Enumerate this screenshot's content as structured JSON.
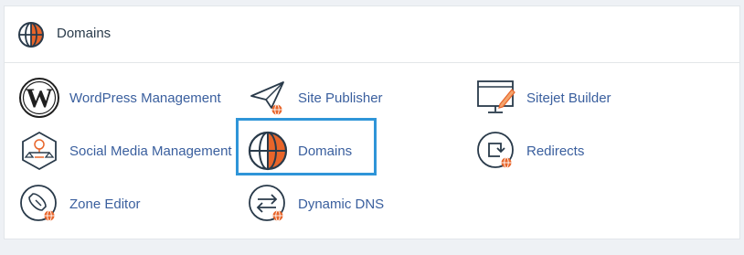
{
  "header": {
    "title": "Domains",
    "icon": "globe-icon"
  },
  "items": [
    {
      "label": "WordPress Management",
      "icon": "wordpress-icon"
    },
    {
      "label": "Site Publisher",
      "icon": "paper-plane-icon"
    },
    {
      "label": "Sitejet Builder",
      "icon": "monitor-pencil-icon"
    },
    {
      "label": "Social Media Management",
      "icon": "social-media-icon"
    },
    {
      "label": "Domains",
      "icon": "globe-icon"
    },
    {
      "label": "Redirects",
      "icon": "redirect-icon"
    },
    {
      "label": "Zone Editor",
      "icon": "rocket-icon"
    },
    {
      "label": "Dynamic DNS",
      "icon": "exchange-arrows-icon"
    }
  ],
  "colors": {
    "link": "#3a5f9e",
    "accent": "#e8652a",
    "highlight": "#2f95d8",
    "icon_stroke": "#293a4a"
  }
}
